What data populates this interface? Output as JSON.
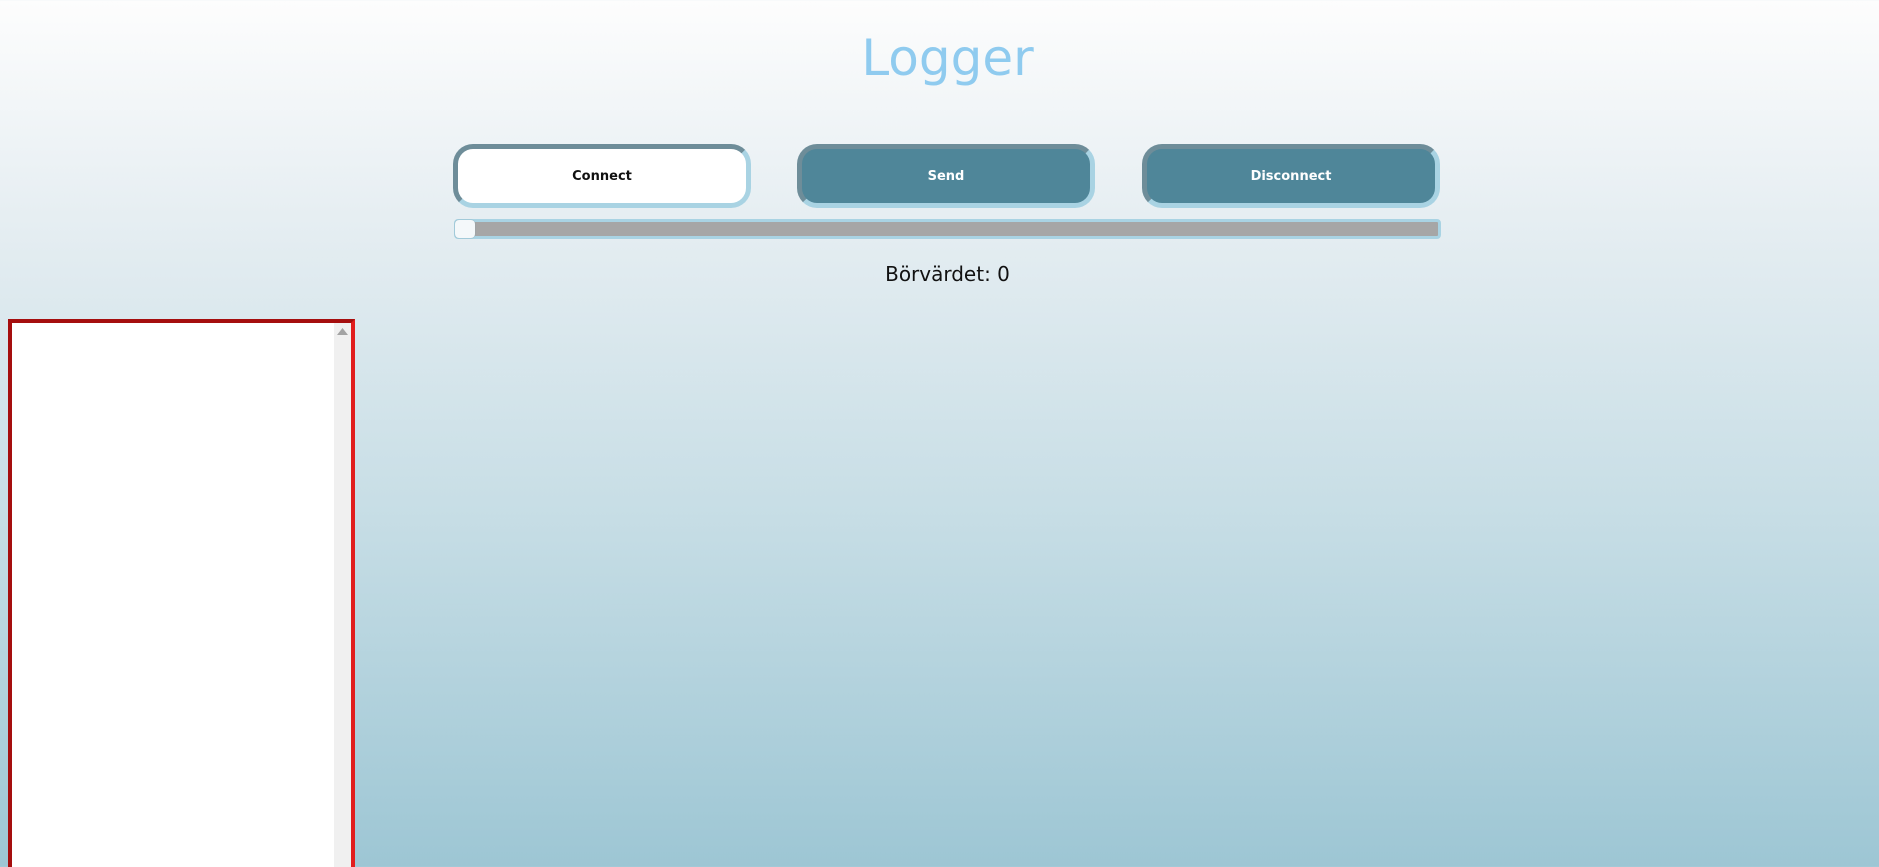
{
  "header": {
    "title": "Logger"
  },
  "controls": {
    "connect_label": "Connect",
    "send_label": "Send",
    "disconnect_label": "Disconnect"
  },
  "slider": {
    "value": 0
  },
  "setpoint": {
    "text": "Börvärdet: 0"
  },
  "log": {
    "content": ""
  },
  "colors": {
    "title": "#8fcbef",
    "button_dark": "#4f8699",
    "button_light": "#ffffff",
    "log_border": "#e11d1d"
  },
  "icons": {
    "scroll_up": "scroll-up-arrow-icon"
  }
}
